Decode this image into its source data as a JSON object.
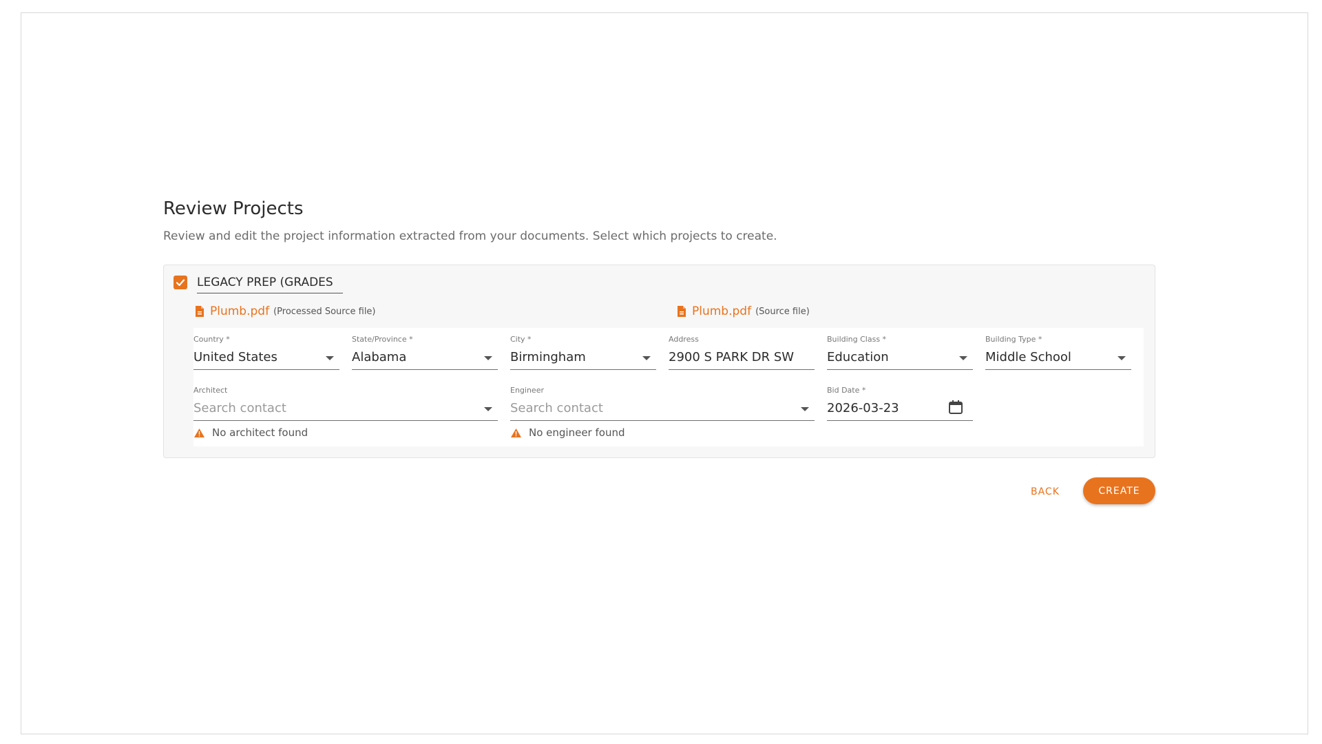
{
  "header": {
    "title": "Review Projects",
    "subtitle": "Review and edit the project information extracted from your documents. Select which projects to create."
  },
  "project": {
    "checked": true,
    "name": "LEGACY PREP (GRADES",
    "files": [
      {
        "name": "Plumb.pdf",
        "note": "(Processed Source file)"
      },
      {
        "name": "Plumb.pdf",
        "note": "(Source file)"
      }
    ],
    "fields": {
      "country": {
        "label": "Country *",
        "value": "United States"
      },
      "state": {
        "label": "State/Province *",
        "value": "Alabama"
      },
      "city": {
        "label": "City *",
        "value": "Birmingham"
      },
      "address": {
        "label": "Address",
        "value": "2900 S PARK DR SW"
      },
      "building_class": {
        "label": "Building Class *",
        "value": "Education"
      },
      "building_type": {
        "label": "Building Type *",
        "value": "Middle School"
      },
      "architect": {
        "label": "Architect",
        "placeholder": "Search contact",
        "warning": "No architect found"
      },
      "engineer": {
        "label": "Engineer",
        "placeholder": "Search contact",
        "warning": "No engineer found"
      },
      "bid_date": {
        "label": "Bid Date *",
        "value": "2026-03-23"
      }
    }
  },
  "actions": {
    "back_label": "BACK",
    "create_label": "CREATE"
  },
  "colors": {
    "accent": "#e8731e"
  },
  "icons": [
    "checkbox-checked-icon",
    "file-icon",
    "dropdown-caret-icon",
    "calendar-icon",
    "warning-icon"
  ]
}
